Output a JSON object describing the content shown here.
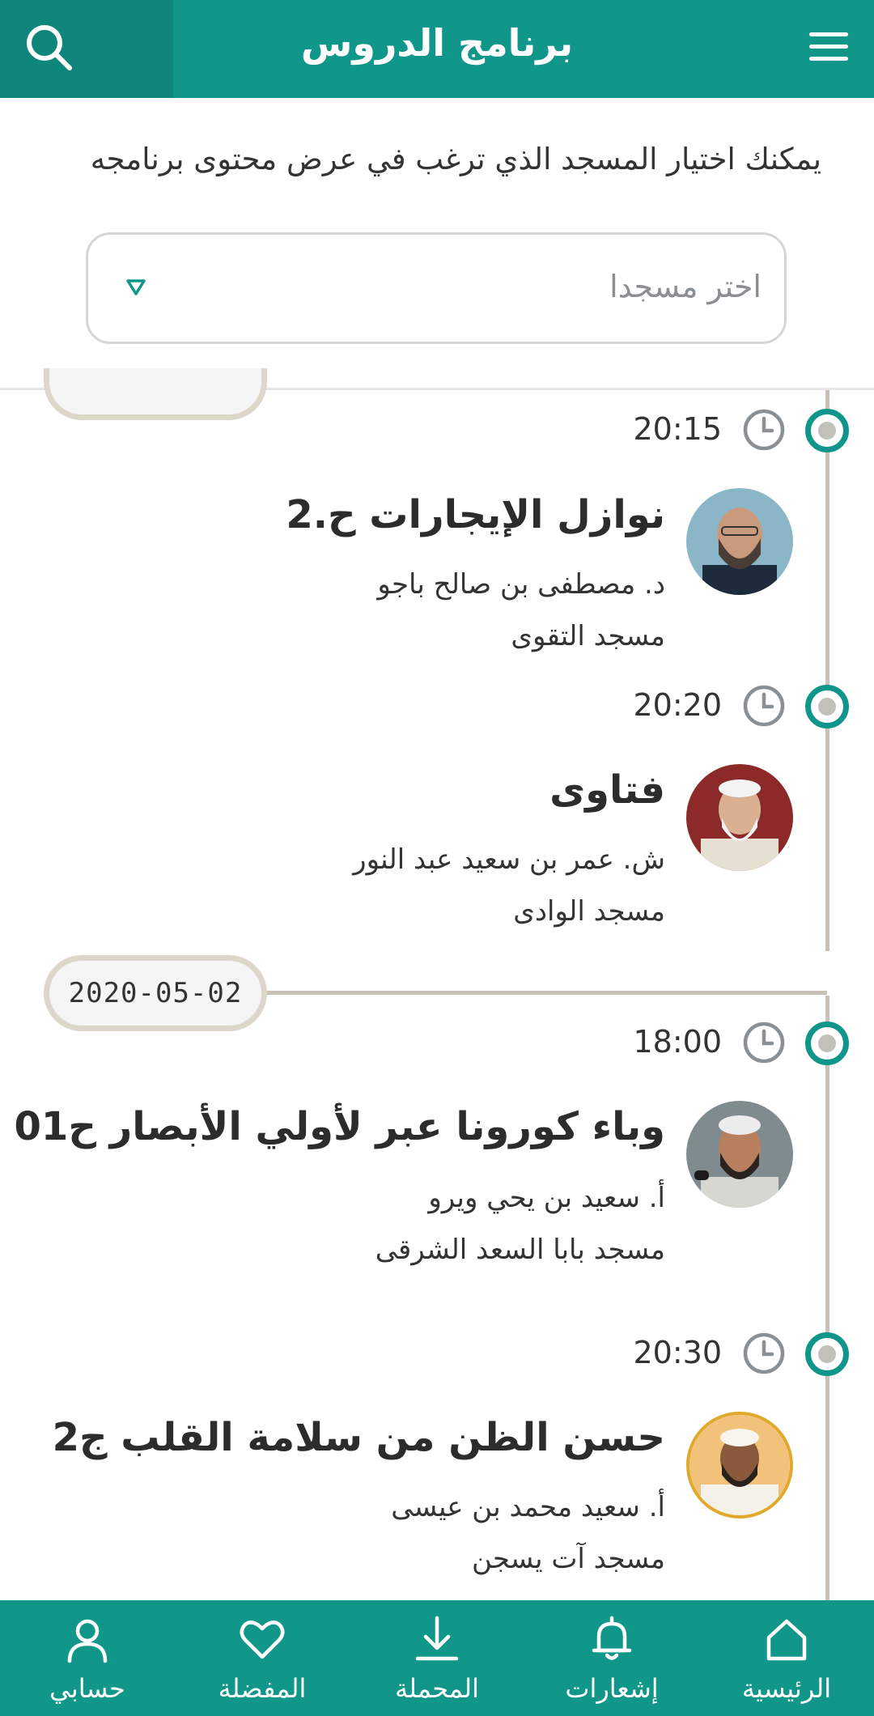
{
  "header": {
    "title": "برنامج الدروس"
  },
  "intro_text": "يمكنك اختيار المسجد الذي ترغب في عرض محتوى برنامجه",
  "mosque_select": {
    "placeholder": "اختر مسجدا"
  },
  "date_groups": [
    {
      "date": "2020-05-02"
    }
  ],
  "lessons": [
    {
      "time": "20:15",
      "title": "نوازل الإيجارات ح.2",
      "speaker": "د. مصطفى بن صالح باجو",
      "mosque": "مسجد التقوى"
    },
    {
      "time": "20:20",
      "title": "فتاوى",
      "speaker": "ش. عمر بن سعيد عبد النور",
      "mosque": "مسجد الوادى"
    },
    {
      "time": "18:00",
      "title": "وباء كورونا عبر لأولي الأبصار ح01",
      "speaker": "أ. سعيد بن يحي ويرو",
      "mosque": "مسجد بابا السعد الشرقى"
    },
    {
      "time": "20:30",
      "title": "حسن الظن من سلامة القلب ج2",
      "speaker": "أ. سعيد محمد بن عيسى",
      "mosque": "مسجد آت يسجن"
    }
  ],
  "bottom_nav": {
    "account": "حسابي",
    "favorites": "المفضلة",
    "downloads": "المحملة",
    "notifications": "إشعارات",
    "home": "الرئيسية"
  },
  "colors": {
    "primary": "#11968a",
    "timeline": "#c9c2b4",
    "accent_ring": "#e0a92b"
  }
}
